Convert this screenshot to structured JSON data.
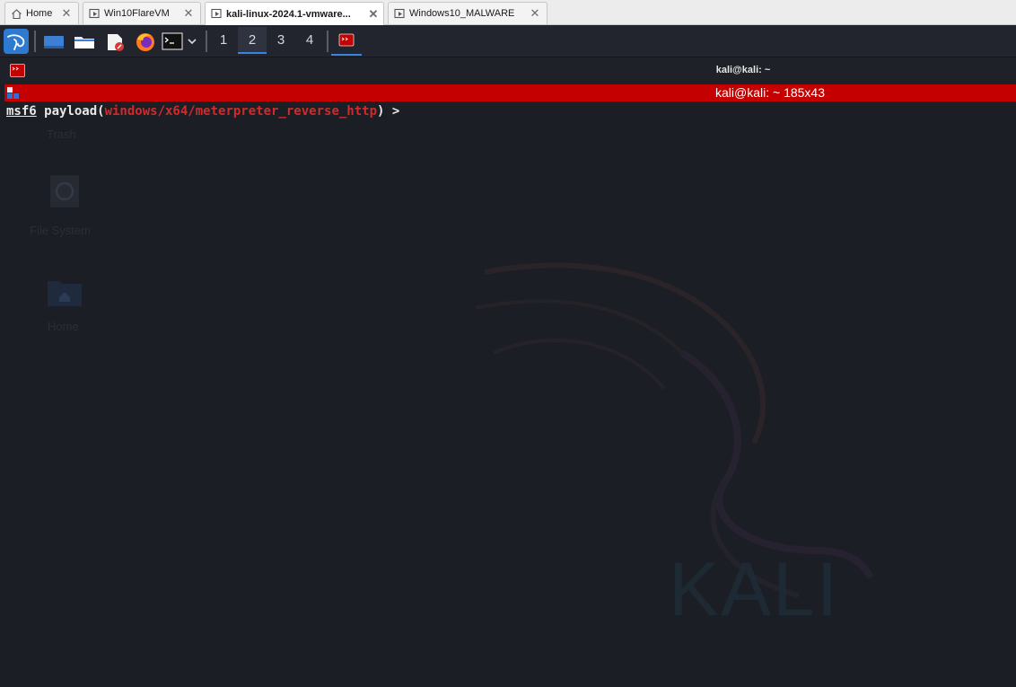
{
  "tabs": [
    {
      "label": "Home",
      "icon": "home-icon"
    },
    {
      "label": "Win10FlareVM",
      "icon": "vm-icon"
    },
    {
      "label": "kali-linux-2024.1-vmware...",
      "icon": "vm-icon",
      "active": true
    },
    {
      "label": "Windows10_MALWARE",
      "icon": "vm-icon"
    }
  ],
  "panel": {
    "workspaces": [
      "1",
      "2",
      "3",
      "4"
    ],
    "active_workspace": "2"
  },
  "window": {
    "title": "kali@kali: ~"
  },
  "terminal_tab": {
    "title": "kali@kali: ~ 185x43"
  },
  "terminal": {
    "prompt_msf": "msf6",
    "prompt_cmd": " payload(",
    "prompt_module": "windows/x64/meterpreter_reverse_http",
    "prompt_end": ") >"
  },
  "desktop": {
    "icons": [
      {
        "label": "Trash"
      },
      {
        "label": "File System"
      },
      {
        "label": "Home"
      }
    ],
    "watermark": "KALI"
  },
  "colors": {
    "terminal_bg": "#1c1e25",
    "tab_bar_red": "#c40000",
    "module_red": "#d22a2a",
    "accent_blue": "#3584e4"
  }
}
